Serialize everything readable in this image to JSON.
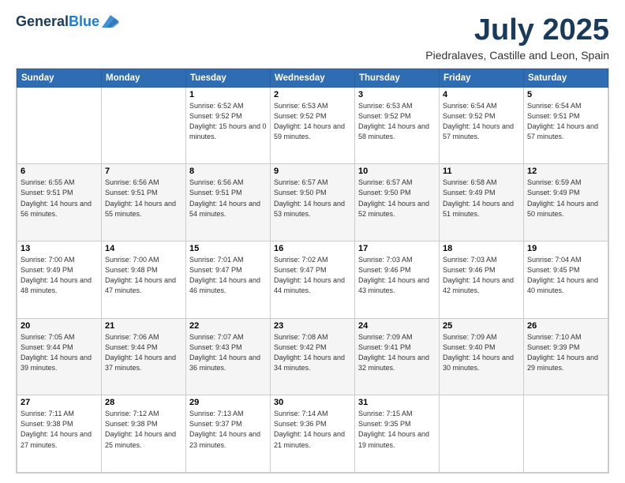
{
  "header": {
    "logo": {
      "general": "General",
      "blue": "Blue"
    },
    "title": "July 2025",
    "location": "Piedralaves, Castille and Leon, Spain"
  },
  "calendar": {
    "days_of_week": [
      "Sunday",
      "Monday",
      "Tuesday",
      "Wednesday",
      "Thursday",
      "Friday",
      "Saturday"
    ],
    "weeks": [
      [
        {
          "day": "",
          "sunrise": "",
          "sunset": "",
          "daylight": ""
        },
        {
          "day": "",
          "sunrise": "",
          "sunset": "",
          "daylight": ""
        },
        {
          "day": "1",
          "sunrise": "Sunrise: 6:52 AM",
          "sunset": "Sunset: 9:52 PM",
          "daylight": "Daylight: 15 hours and 0 minutes."
        },
        {
          "day": "2",
          "sunrise": "Sunrise: 6:53 AM",
          "sunset": "Sunset: 9:52 PM",
          "daylight": "Daylight: 14 hours and 59 minutes."
        },
        {
          "day": "3",
          "sunrise": "Sunrise: 6:53 AM",
          "sunset": "Sunset: 9:52 PM",
          "daylight": "Daylight: 14 hours and 58 minutes."
        },
        {
          "day": "4",
          "sunrise": "Sunrise: 6:54 AM",
          "sunset": "Sunset: 9:52 PM",
          "daylight": "Daylight: 14 hours and 57 minutes."
        },
        {
          "day": "5",
          "sunrise": "Sunrise: 6:54 AM",
          "sunset": "Sunset: 9:51 PM",
          "daylight": "Daylight: 14 hours and 57 minutes."
        }
      ],
      [
        {
          "day": "6",
          "sunrise": "Sunrise: 6:55 AM",
          "sunset": "Sunset: 9:51 PM",
          "daylight": "Daylight: 14 hours and 56 minutes."
        },
        {
          "day": "7",
          "sunrise": "Sunrise: 6:56 AM",
          "sunset": "Sunset: 9:51 PM",
          "daylight": "Daylight: 14 hours and 55 minutes."
        },
        {
          "day": "8",
          "sunrise": "Sunrise: 6:56 AM",
          "sunset": "Sunset: 9:51 PM",
          "daylight": "Daylight: 14 hours and 54 minutes."
        },
        {
          "day": "9",
          "sunrise": "Sunrise: 6:57 AM",
          "sunset": "Sunset: 9:50 PM",
          "daylight": "Daylight: 14 hours and 53 minutes."
        },
        {
          "day": "10",
          "sunrise": "Sunrise: 6:57 AM",
          "sunset": "Sunset: 9:50 PM",
          "daylight": "Daylight: 14 hours and 52 minutes."
        },
        {
          "day": "11",
          "sunrise": "Sunrise: 6:58 AM",
          "sunset": "Sunset: 9:49 PM",
          "daylight": "Daylight: 14 hours and 51 minutes."
        },
        {
          "day": "12",
          "sunrise": "Sunrise: 6:59 AM",
          "sunset": "Sunset: 9:49 PM",
          "daylight": "Daylight: 14 hours and 50 minutes."
        }
      ],
      [
        {
          "day": "13",
          "sunrise": "Sunrise: 7:00 AM",
          "sunset": "Sunset: 9:49 PM",
          "daylight": "Daylight: 14 hours and 48 minutes."
        },
        {
          "day": "14",
          "sunrise": "Sunrise: 7:00 AM",
          "sunset": "Sunset: 9:48 PM",
          "daylight": "Daylight: 14 hours and 47 minutes."
        },
        {
          "day": "15",
          "sunrise": "Sunrise: 7:01 AM",
          "sunset": "Sunset: 9:47 PM",
          "daylight": "Daylight: 14 hours and 46 minutes."
        },
        {
          "day": "16",
          "sunrise": "Sunrise: 7:02 AM",
          "sunset": "Sunset: 9:47 PM",
          "daylight": "Daylight: 14 hours and 44 minutes."
        },
        {
          "day": "17",
          "sunrise": "Sunrise: 7:03 AM",
          "sunset": "Sunset: 9:46 PM",
          "daylight": "Daylight: 14 hours and 43 minutes."
        },
        {
          "day": "18",
          "sunrise": "Sunrise: 7:03 AM",
          "sunset": "Sunset: 9:46 PM",
          "daylight": "Daylight: 14 hours and 42 minutes."
        },
        {
          "day": "19",
          "sunrise": "Sunrise: 7:04 AM",
          "sunset": "Sunset: 9:45 PM",
          "daylight": "Daylight: 14 hours and 40 minutes."
        }
      ],
      [
        {
          "day": "20",
          "sunrise": "Sunrise: 7:05 AM",
          "sunset": "Sunset: 9:44 PM",
          "daylight": "Daylight: 14 hours and 39 minutes."
        },
        {
          "day": "21",
          "sunrise": "Sunrise: 7:06 AM",
          "sunset": "Sunset: 9:44 PM",
          "daylight": "Daylight: 14 hours and 37 minutes."
        },
        {
          "day": "22",
          "sunrise": "Sunrise: 7:07 AM",
          "sunset": "Sunset: 9:43 PM",
          "daylight": "Daylight: 14 hours and 36 minutes."
        },
        {
          "day": "23",
          "sunrise": "Sunrise: 7:08 AM",
          "sunset": "Sunset: 9:42 PM",
          "daylight": "Daylight: 14 hours and 34 minutes."
        },
        {
          "day": "24",
          "sunrise": "Sunrise: 7:09 AM",
          "sunset": "Sunset: 9:41 PM",
          "daylight": "Daylight: 14 hours and 32 minutes."
        },
        {
          "day": "25",
          "sunrise": "Sunrise: 7:09 AM",
          "sunset": "Sunset: 9:40 PM",
          "daylight": "Daylight: 14 hours and 30 minutes."
        },
        {
          "day": "26",
          "sunrise": "Sunrise: 7:10 AM",
          "sunset": "Sunset: 9:39 PM",
          "daylight": "Daylight: 14 hours and 29 minutes."
        }
      ],
      [
        {
          "day": "27",
          "sunrise": "Sunrise: 7:11 AM",
          "sunset": "Sunset: 9:38 PM",
          "daylight": "Daylight: 14 hours and 27 minutes."
        },
        {
          "day": "28",
          "sunrise": "Sunrise: 7:12 AM",
          "sunset": "Sunset: 9:38 PM",
          "daylight": "Daylight: 14 hours and 25 minutes."
        },
        {
          "day": "29",
          "sunrise": "Sunrise: 7:13 AM",
          "sunset": "Sunset: 9:37 PM",
          "daylight": "Daylight: 14 hours and 23 minutes."
        },
        {
          "day": "30",
          "sunrise": "Sunrise: 7:14 AM",
          "sunset": "Sunset: 9:36 PM",
          "daylight": "Daylight: 14 hours and 21 minutes."
        },
        {
          "day": "31",
          "sunrise": "Sunrise: 7:15 AM",
          "sunset": "Sunset: 9:35 PM",
          "daylight": "Daylight: 14 hours and 19 minutes."
        },
        {
          "day": "",
          "sunrise": "",
          "sunset": "",
          "daylight": ""
        },
        {
          "day": "",
          "sunrise": "",
          "sunset": "",
          "daylight": ""
        }
      ]
    ]
  }
}
